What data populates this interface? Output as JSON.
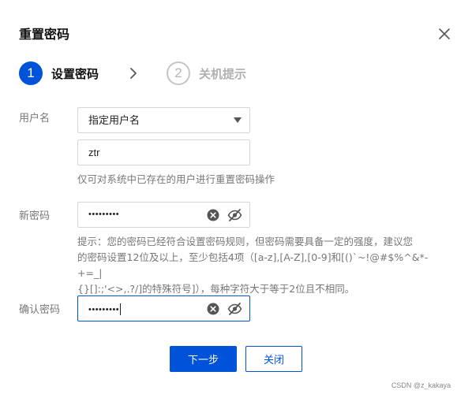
{
  "dialog": {
    "title": "重置密码",
    "close_icon": "close-icon"
  },
  "steps": [
    {
      "number": "1",
      "label": "设置密码",
      "state": "active"
    },
    {
      "number": "2",
      "label": "关机提示",
      "state": "inactive"
    }
  ],
  "form": {
    "username": {
      "label": "用户名",
      "select_value": "指定用户名",
      "input_value": "ztr",
      "help": "仅可对系统中已存在的用户进行重置密码操作"
    },
    "new_password": {
      "label": "新密码",
      "masked_value": "•••••••••",
      "hint_lines": [
        "提示：您的密码已经符合设置密码规则，但密码需要具备一定的强度，建议您",
        "的密码设置12位及以上，至少包括4项（[a-z],[A-Z],[0-9]和[()`~!@#$%^&*-+=_|",
        "{}[]:;'<>,.?/]的特殊符号]），每种字符大于等于2位且不相同。"
      ]
    },
    "confirm_password": {
      "label": "确认密码",
      "masked_value": "•••••••••"
    }
  },
  "buttons": {
    "next": "下一步",
    "close": "关闭"
  },
  "colors": {
    "accent": "#0052d9",
    "border": "#d6d6d6",
    "muted_text": "#777777"
  },
  "watermark": "CSDN @z_kakaya"
}
